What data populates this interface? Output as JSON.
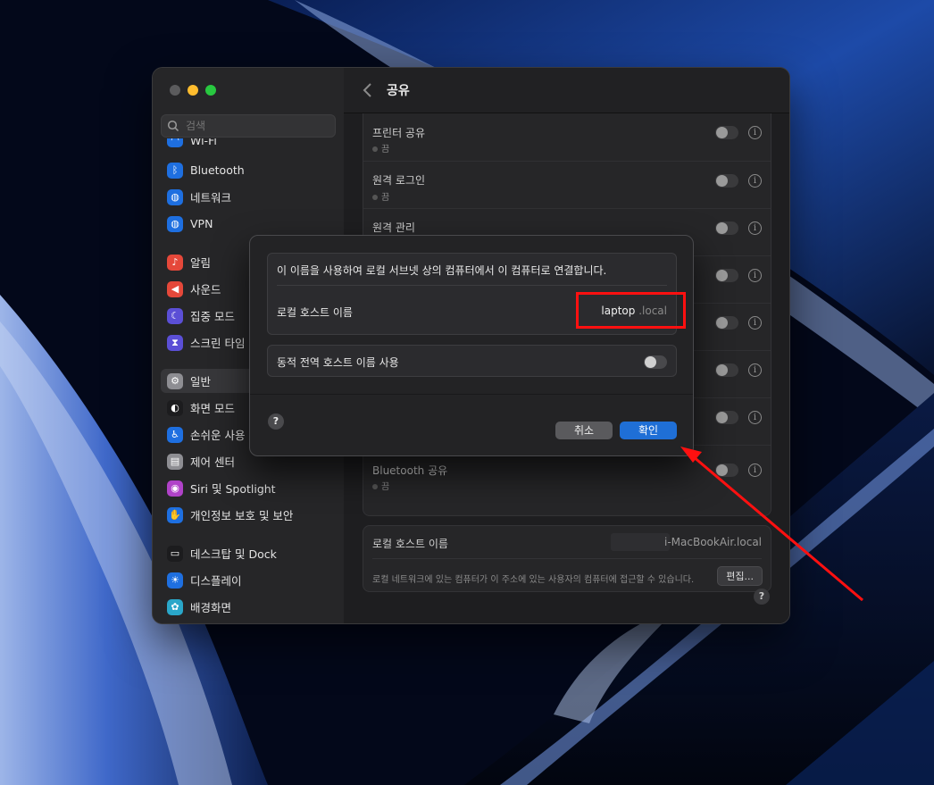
{
  "window": {
    "title": "공유",
    "search_placeholder": "검색"
  },
  "sidebar": {
    "items": [
      {
        "label": "Wi-Fi",
        "icon": "wifi-icon",
        "color": "#1e6fe0"
      },
      {
        "label": "Bluetooth",
        "icon": "bluetooth-icon",
        "color": "#1e6fe0"
      },
      {
        "label": "네트워크",
        "icon": "globe-icon",
        "color": "#1e6fe0"
      },
      {
        "label": "VPN",
        "icon": "globe-icon",
        "color": "#1e6fe0"
      },
      {
        "label": "알림",
        "icon": "bell-icon",
        "color": "#e5483a"
      },
      {
        "label": "사운드",
        "icon": "speaker-icon",
        "color": "#e5483a"
      },
      {
        "label": "집중 모드",
        "icon": "moon-icon",
        "color": "#5b4fd6"
      },
      {
        "label": "스크린 타임",
        "icon": "hourglass-icon",
        "color": "#5b4fd6"
      },
      {
        "label": "일반",
        "icon": "gear-icon",
        "color": "#8e8e93"
      },
      {
        "label": "화면 모드",
        "icon": "appearance-icon",
        "color": "#1c1c1e"
      },
      {
        "label": "손쉬운 사용",
        "icon": "accessibility-icon",
        "color": "#1e6fe0"
      },
      {
        "label": "제어 센터",
        "icon": "control-center-icon",
        "color": "#8e8e93"
      },
      {
        "label": "Siri 및 Spotlight",
        "icon": "siri-icon",
        "color": "#b042c8"
      },
      {
        "label": "개인정보 보호 및 보안",
        "icon": "hand-icon",
        "color": "#1e6fe0"
      },
      {
        "label": "데스크탑 및 Dock",
        "icon": "dock-icon",
        "color": "#1c1c1e"
      },
      {
        "label": "디스플레이",
        "icon": "sun-icon",
        "color": "#1e6fe0"
      },
      {
        "label": "배경화면",
        "icon": "flower-icon",
        "color": "#2aa7c9"
      }
    ]
  },
  "sharing": {
    "rows": [
      {
        "title": "프린터 공유",
        "status": "끔"
      },
      {
        "title": "원격 로그인",
        "status": "끔"
      },
      {
        "title": "원격 관리",
        "status": ""
      },
      {
        "title": "Bluetooth 공유",
        "status": "끔"
      }
    ],
    "hostname_label": "로컬 호스트 이름",
    "hostname_value": "i-MacBookAir.local",
    "hostname_desc": "로컬 네트워크에 있는 컴퓨터가 이 주소에 있는 사용자의 컴퓨터에 접근할 수 있습니다.",
    "edit_label": "편집...",
    "help_label": "?"
  },
  "dialog": {
    "description": "이 이름을 사용하여 로컬 서브넷 상의 컴퓨터에서 이 컴퓨터로 연결합니다.",
    "host_label": "로컬 호스트 이름",
    "host_value": "laptop",
    "host_suffix": ".local",
    "dynamic_label": "동적 전역 호스트 이름 사용",
    "help_label": "?",
    "cancel_label": "취소",
    "ok_label": "확인"
  },
  "colors": {
    "accent": "#1f6fd6",
    "annotation": "#ff1010"
  }
}
